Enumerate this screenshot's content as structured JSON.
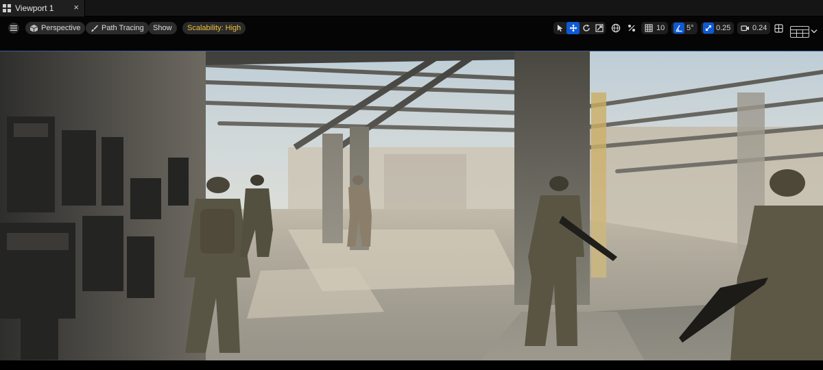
{
  "tab": {
    "title": "Viewport 1",
    "close": "×",
    "icon": "viewport-grid-icon"
  },
  "toolbar": {
    "menu_icon": "hamburger-icon",
    "perspective": {
      "label": "Perspective",
      "icon": "cube-icon"
    },
    "view_mode": {
      "label": "Path Tracing",
      "icon": "brush-icon"
    },
    "show_label": "Show",
    "scalability_label": "Scalability: High",
    "transform_tools": [
      "select-icon",
      "move-icon",
      "rotate-icon",
      "scale-icon"
    ],
    "active_tool": "move-icon",
    "world_local_icon": "globe-icon",
    "surface_snap_icon": "surface-snap-icon",
    "grid_snap": {
      "icon": "grid-icon",
      "value": "10"
    },
    "rotation_snap": {
      "icon": "angle-icon",
      "value": "5°"
    },
    "scale_snap": {
      "icon": "scale-snap-icon",
      "value": "0.25"
    },
    "camera_speed": {
      "icon": "camera-icon",
      "value": "0.24"
    },
    "maximize_icon": "maximize-icon",
    "layout_icon": "viewport-layout-icon",
    "layout_dropdown_icon": "chevron-down-icon"
  },
  "colors": {
    "accent_blue": "#0e5ad6",
    "scalability_yellow": "#f0c23a",
    "toolbar_bg": "#050505",
    "tab_bg": "#1f1f1f"
  },
  "scene": {
    "description_name": "soldiers-in-industrial-structure",
    "soldier_count": 6
  }
}
